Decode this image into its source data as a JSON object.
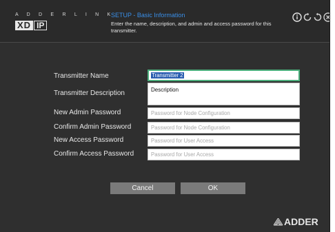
{
  "header": {
    "logo_text": "A D D E R L I N K",
    "logo_xd": "XD",
    "logo_ip": "IP",
    "title": "SETUP - Basic Information",
    "description": "Enter the name, description, and admin and access password for this transmitter."
  },
  "icons": [
    "info-icon",
    "refresh-icon",
    "reload-icon",
    "close-icon"
  ],
  "form": {
    "fields": [
      {
        "label": "Transmitter Name",
        "value": "Transmitter 2",
        "placeholder": ""
      },
      {
        "label": "Transmitter Description",
        "value": "Description",
        "placeholder": ""
      },
      {
        "label": "New Admin Password",
        "value": "",
        "placeholder": "Password for Node Configuration"
      },
      {
        "label": "Confirm Admin Password",
        "value": "",
        "placeholder": "Password for Node Configuration"
      },
      {
        "label": "New Access Password",
        "value": "",
        "placeholder": "Password for User Access"
      },
      {
        "label": "Confirm Access Password",
        "value": "",
        "placeholder": "Password for User Access"
      }
    ]
  },
  "buttons": {
    "cancel": "Cancel",
    "ok": "OK"
  },
  "brand": "ADDER",
  "colors": {
    "accent_title": "#3a8fe8",
    "active_border": "#4caf7d",
    "background": "#2f2f2f",
    "button": "#7a7a7a"
  }
}
